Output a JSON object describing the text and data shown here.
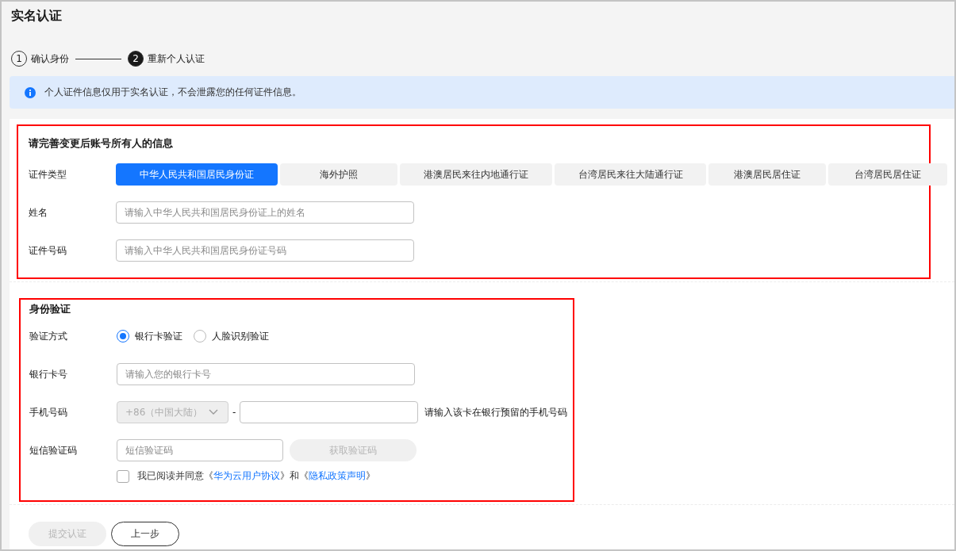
{
  "page_title": "实名认证",
  "steps": [
    {
      "number": "1",
      "label": "确认身份",
      "current": false
    },
    {
      "number": "2",
      "label": "重新个人认证",
      "current": true
    }
  ],
  "notice": {
    "text": "个人证件信息仅用于实名认证，不会泄露您的任何证件信息。"
  },
  "owner_section": {
    "title": "请完善变更后账号所有人的信息",
    "highlighted": true,
    "id_type": {
      "label": "证件类型",
      "options": [
        {
          "label": "中华人民共和国居民身份证",
          "selected": true
        },
        {
          "label": "海外护照",
          "selected": false
        },
        {
          "label": "港澳居民来往内地通行证",
          "selected": false
        },
        {
          "label": "台湾居民来往大陆通行证",
          "selected": false
        },
        {
          "label": "港澳居民居住证",
          "selected": false
        },
        {
          "label": "台湾居民居住证",
          "selected": false
        }
      ]
    },
    "fields": [
      {
        "label": "姓名",
        "placeholder": "请输入中华人民共和国居民身份证上的姓名"
      },
      {
        "label": "证件号码",
        "placeholder": "请输入中华人民共和国居民身份证号码"
      }
    ]
  },
  "verify_section": {
    "title": "身份验证",
    "highlighted": true,
    "method": {
      "label": "验证方式",
      "options": [
        {
          "label": "银行卡验证",
          "selected": true
        },
        {
          "label": "人脸识别验证",
          "selected": false
        }
      ]
    },
    "bank_card": {
      "label": "银行卡号",
      "placeholder": "请输入您的银行卡号"
    },
    "phone": {
      "label": "手机号码",
      "country": "+86（中国大陆）",
      "country_disabled": true,
      "separator": "-",
      "hint": "请输入该卡在银行预留的手机号码"
    },
    "sms": {
      "label": "短信验证码",
      "placeholder": "短信验证码",
      "button": "获取验证码",
      "button_disabled": true
    },
    "agreement": {
      "checked": false,
      "parts": [
        {
          "kind": "text",
          "text": "我已阅读并同意《"
        },
        {
          "kind": "link",
          "text": "华为云用户协议"
        },
        {
          "kind": "text",
          "text": "》和《"
        },
        {
          "kind": "link",
          "text": "隐私政策声明"
        },
        {
          "kind": "text",
          "text": "》"
        }
      ]
    }
  },
  "actions": [
    {
      "label": "提交认证",
      "disabled": true
    },
    {
      "label": "上一步",
      "disabled": false
    }
  ]
}
